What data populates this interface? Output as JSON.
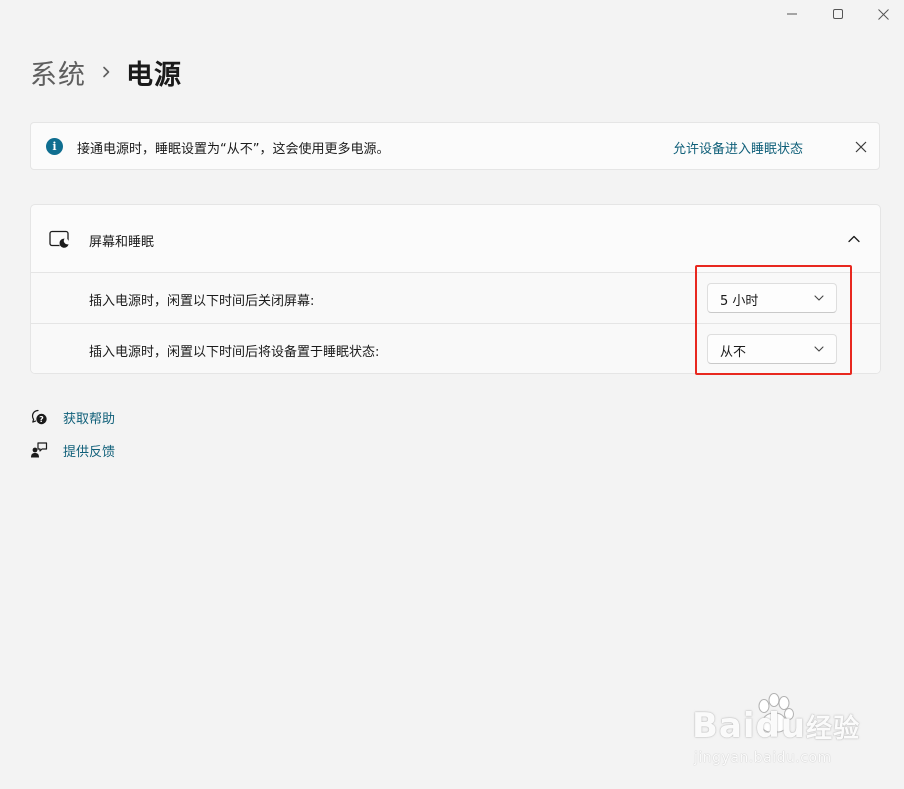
{
  "breadcrumb": {
    "parent": "系统",
    "current": "电源"
  },
  "infobar": {
    "message": "接通电源时，睡眠设置为“从不”，这会使用更多电源。",
    "action_link": "允许设备进入睡眠状态",
    "info_icon_glyph": "i"
  },
  "screen_sleep": {
    "title": "屏幕和睡眠",
    "expanded": true,
    "rows": [
      {
        "label": "插入电源时，闲置以下时间后关闭屏幕:",
        "value": "5 小时"
      },
      {
        "label": "插入电源时，闲置以下时间后将设备置于睡眠状态:",
        "value": "从不"
      }
    ]
  },
  "help": {
    "get_help": "获取帮助",
    "give_feedback": "提供反馈"
  },
  "watermark": {
    "brand": "Baidu",
    "brand_suffix": "经验",
    "url": "jingyan.baidu.com"
  },
  "colors": {
    "accent_link": "#0f5f79",
    "info_icon": "#0f6e90",
    "highlight": "#e8281f",
    "background": "#f3f3f3"
  },
  "icons": {
    "minimize": "minimize-icon",
    "maximize": "maximize-icon",
    "close": "close-icon",
    "breadcrumb_separator": "chevron-right-icon",
    "info": "info-icon",
    "dismiss": "close-icon",
    "screen_sleep": "screen-sleep-icon",
    "collapse": "chevron-up-icon",
    "dropdown": "chevron-down-icon",
    "help": "help-icon",
    "feedback": "feedback-icon"
  }
}
